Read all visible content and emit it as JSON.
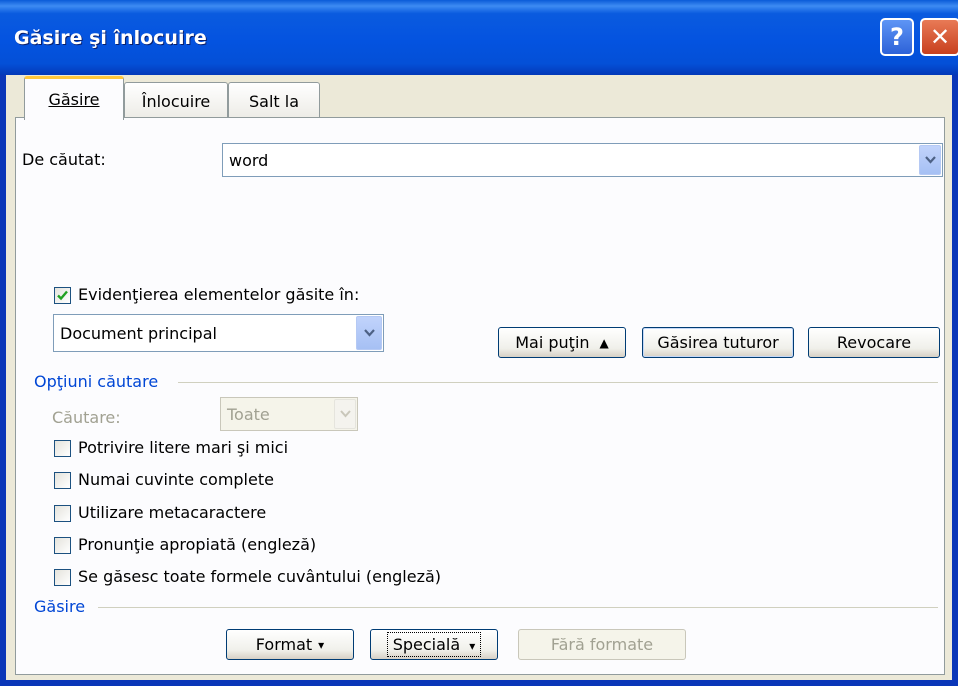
{
  "window": {
    "title": "Găsire şi înlocuire",
    "help_label": "?",
    "close_label": "✕"
  },
  "tabs": [
    {
      "label": "Găsire",
      "active": true
    },
    {
      "label": "Înlocuire",
      "active": false
    },
    {
      "label": "Salt la",
      "active": false
    }
  ],
  "find": {
    "label": "De căutat:",
    "value": "word"
  },
  "highlight": {
    "checkbox_label": "Evidenţierea elementelor găsite în:",
    "checked": true,
    "select_value": "Document principal"
  },
  "buttons": {
    "less": "Mai puţin",
    "less_arrow": "▲",
    "find_all": "Găsirea tuturor",
    "cancel": "Revocare"
  },
  "search_options": {
    "group_label": "Opţiuni căutare",
    "search_label": "Căutare:",
    "search_value": "Toate",
    "options": [
      {
        "label": "Potrivire litere mari şi mici",
        "checked": false
      },
      {
        "label": "Numai cuvinte complete",
        "checked": false
      },
      {
        "label": "Utilizare metacaractere",
        "checked": false
      },
      {
        "label": "Pronunţie apropiată (engleză)",
        "checked": false
      },
      {
        "label": "Se găsesc toate formele cuvântului (engleză)",
        "checked": false
      }
    ]
  },
  "find_group": {
    "group_label": "Găsire",
    "format": "Format",
    "special": "Specială",
    "no_format": "Fără formate",
    "menu_arrow": "▾"
  },
  "colors": {
    "titlebar": "#0453e0",
    "dialog_bg": "#ece9d8",
    "group_label": "#0046d5",
    "checkmark": "#21a121"
  }
}
